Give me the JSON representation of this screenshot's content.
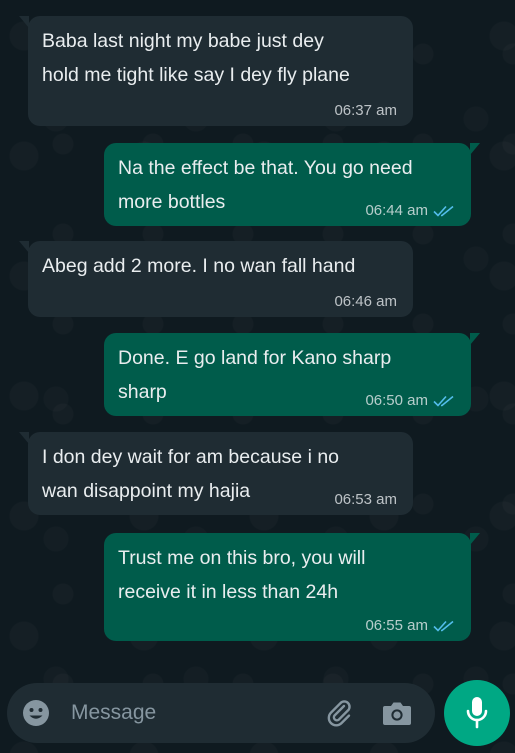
{
  "messages": [
    {
      "direction": "incoming",
      "text": "Baba last night my babe just dey\nhold me tight like say I dey fly plane",
      "time": "06:37 am"
    },
    {
      "direction": "outgoing",
      "text": "Na the effect be that. You go need\nmore bottles",
      "time": "06:44 am",
      "status": "read"
    },
    {
      "direction": "incoming",
      "text": "Abeg add 2 more. I no wan fall hand",
      "time": "06:46 am"
    },
    {
      "direction": "outgoing",
      "text": "Done. E go land for Kano sharp\nsharp",
      "time": "06:50 am",
      "status": "read"
    },
    {
      "direction": "incoming",
      "text": "I don dey wait for am because i no\nwan disappoint my hajia",
      "time": "06:53 am"
    },
    {
      "direction": "outgoing",
      "text": "Trust me on this bro, you will\nreceive it in less than 24h",
      "time": "06:55 am",
      "status": "read"
    }
  ],
  "composer": {
    "placeholder": "Message",
    "icons": [
      "emoji-icon",
      "paperclip-icon",
      "camera-icon",
      "microphone-icon"
    ]
  },
  "colors": {
    "incoming_bubble": "#1f2c33",
    "outgoing_bubble": "#005c4b",
    "read_ticks": "#53bdeb",
    "send_button": "#00a884"
  }
}
